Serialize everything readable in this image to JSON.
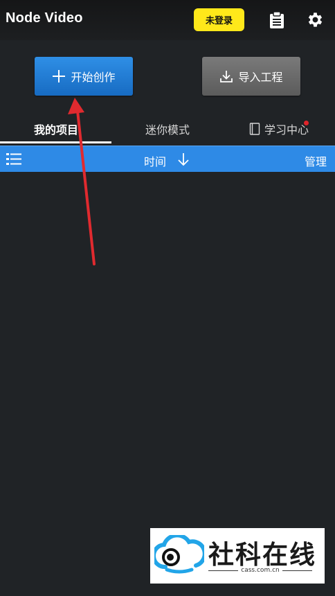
{
  "header": {
    "title": "Node Video",
    "login_label": "未登录",
    "clipboard_icon": "clipboard-icon",
    "settings_icon": "gear-icon"
  },
  "actions": {
    "create_label": "开始创作",
    "create_icon": "plus-icon",
    "import_label": "导入工程",
    "import_icon": "download-icon"
  },
  "tabs": [
    {
      "label": "我的项目",
      "active": true
    },
    {
      "label": "迷你模式",
      "active": false
    },
    {
      "label": "学习中心",
      "active": false,
      "icon": "book-icon",
      "badge": "red-dot"
    }
  ],
  "sortbar": {
    "list_icon": "list-icon",
    "sort_label": "时间",
    "sort_direction_icon": "arrow-down-icon",
    "manage_label": "管理"
  },
  "watermark": {
    "text": "社科在线",
    "url": "cass.com.cn"
  },
  "colors": {
    "background": "#202326",
    "accent_blue": "#2e8ae6",
    "login_yellow": "#ffe81a",
    "annotation_red": "#e02a2f"
  }
}
